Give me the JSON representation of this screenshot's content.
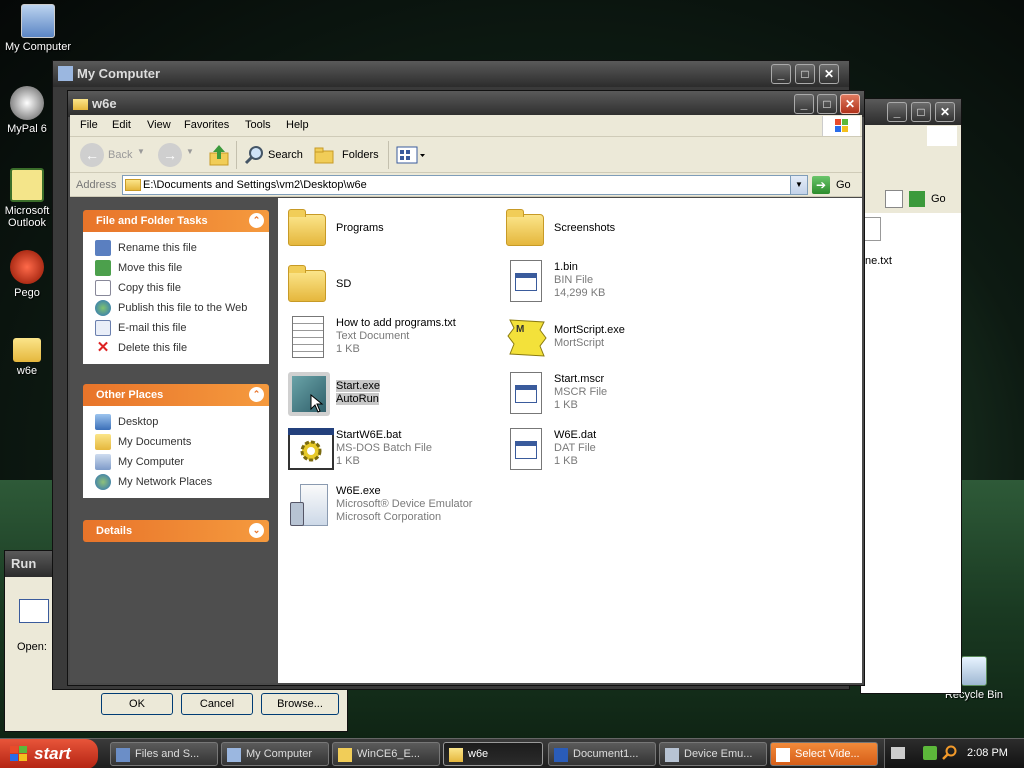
{
  "desktop": {
    "icons": [
      {
        "label": "My Computer"
      },
      {
        "label": "MyPal 6"
      },
      {
        "label": "Microsoft Outlook"
      },
      {
        "label": "Pego"
      },
      {
        "label": "w6e"
      },
      {
        "label": "Recycle Bin"
      }
    ]
  },
  "back_window": {
    "title": "My Computer",
    "go_label": "Go",
    "file_fragment": "ne.txt"
  },
  "run_dialog": {
    "title": "Run",
    "open_label": "Open:",
    "ok": "OK",
    "cancel": "Cancel",
    "browse": "Browse..."
  },
  "main_window": {
    "title": "w6e",
    "menu": [
      "File",
      "Edit",
      "View",
      "Favorites",
      "Tools",
      "Help"
    ],
    "toolbar": {
      "back": "Back",
      "search": "Search",
      "folders": "Folders"
    },
    "address": {
      "label": "Address",
      "value": "E:\\Documents and Settings\\vm2\\Desktop\\w6e",
      "go": "Go"
    },
    "tasks": {
      "file_folder_tasks": {
        "title": "File and Folder Tasks",
        "items": [
          "Rename this file",
          "Move this file",
          "Copy this file",
          "Publish this file to the Web",
          "E-mail this file",
          "Delete this file"
        ]
      },
      "other_places": {
        "title": "Other Places",
        "items": [
          "Desktop",
          "My Documents",
          "My Computer",
          "My Network Places"
        ]
      },
      "details": {
        "title": "Details"
      }
    },
    "files": [
      {
        "name": "Programs",
        "type": "",
        "size": "",
        "icon": "folder-icon"
      },
      {
        "name": "Screenshots",
        "type": "",
        "size": "",
        "icon": "folder-icon"
      },
      {
        "name": "SD",
        "type": "",
        "size": "",
        "icon": "folder-icon"
      },
      {
        "name": "1.bin",
        "type": "BIN File",
        "size": "14,299 KB",
        "icon": "bin-file-icon"
      },
      {
        "name": "How to add programs.txt",
        "type": "Text Document",
        "size": "1 KB",
        "icon": "text-file-icon"
      },
      {
        "name": "MortScript.exe",
        "type": "MortScript",
        "size": "",
        "icon": "mortscript-icon"
      },
      {
        "name": "Start.exe",
        "type": "AutoRun",
        "size": "",
        "icon": "autorun-icon",
        "selected": true
      },
      {
        "name": "Start.mscr",
        "type": "MSCR File",
        "size": "1 KB",
        "icon": "mscr-file-icon"
      },
      {
        "name": "StartW6E.bat",
        "type": "MS-DOS Batch File",
        "size": "1 KB",
        "icon": "batch-file-icon"
      },
      {
        "name": "W6E.dat",
        "type": "DAT File",
        "size": "1 KB",
        "icon": "dat-file-icon"
      },
      {
        "name": "W6E.exe",
        "type": "Microsoft® Device Emulator",
        "size": "Microsoft Corporation",
        "icon": "device-emulator-icon"
      }
    ]
  },
  "taskbar": {
    "start": "start",
    "buttons": [
      {
        "label": "Files and S..."
      },
      {
        "label": "My Computer"
      },
      {
        "label": "WinCE6_E..."
      },
      {
        "label": "w6e",
        "active": true
      },
      {
        "label": "Document1..."
      },
      {
        "label": "Device Emu..."
      },
      {
        "label": "Select Vide..."
      }
    ],
    "clock": "2:08 PM"
  },
  "colors": {
    "task_header": "#e8742a",
    "menu_bg": "#ece9d8",
    "selected": "#c8c8c8"
  }
}
